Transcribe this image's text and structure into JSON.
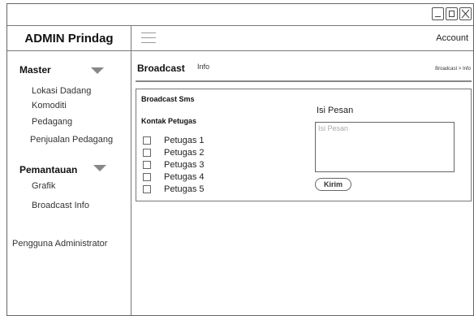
{
  "app": {
    "brand": "ADMIN Prindag",
    "account_label": "Account"
  },
  "window_controls": {
    "minimize_icon": "minimize-icon",
    "maximize_icon": "maximize-icon",
    "close_icon": "close-icon"
  },
  "sidebar": {
    "sections": [
      {
        "label": "Master",
        "icon": "chevron-down-icon",
        "items": [
          {
            "label": "Lokasi Dadang"
          },
          {
            "label": "Komoditi"
          },
          {
            "label": "Pedagang"
          },
          {
            "label": "Penjualan Pedagang"
          }
        ]
      },
      {
        "label": "Pemantauan",
        "icon": "chevron-down-icon",
        "items": [
          {
            "label": "Grafik"
          },
          {
            "label": "Broadcast Info"
          }
        ]
      }
    ],
    "footer_item": "Pengguna Administrator"
  },
  "page": {
    "title": "Broadcast",
    "subtitle": "Info",
    "breadcrumb": "Broadcast > Info"
  },
  "broadcast_panel": {
    "title": "Broadcast Sms",
    "contacts_title": "Kontak Petugas",
    "contacts": [
      {
        "label": "Petugas 1",
        "checked": false
      },
      {
        "label": "Petugas 2",
        "checked": false
      },
      {
        "label": "Petugas 3",
        "checked": false
      },
      {
        "label": "Petugas 4",
        "checked": false
      },
      {
        "label": "Petugas 5",
        "checked": false
      }
    ],
    "message_label": "Isi Pesan",
    "message_value": "",
    "message_placeholder": "Isi Pesan",
    "send_label": "Kirim"
  }
}
